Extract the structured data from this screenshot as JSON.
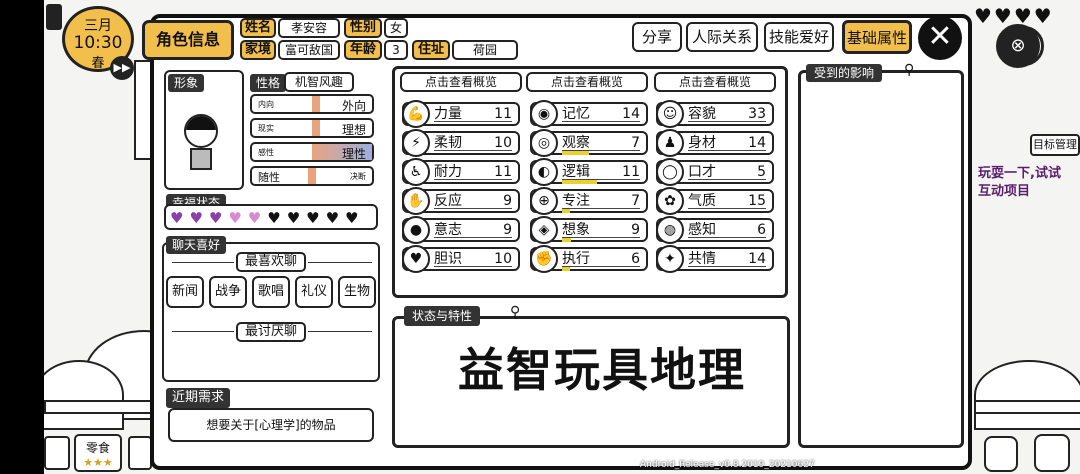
{
  "clock": {
    "month": "三月",
    "time": "10:30",
    "season": "春"
  },
  "tabs": {
    "active": "角色信息",
    "share": "分享",
    "relations": "人际关系",
    "skills": "技能爱好",
    "basic": "基础属性"
  },
  "profile": {
    "name_label": "姓名",
    "name": "孝安容",
    "gender_label": "性别",
    "gender": "女",
    "family_label": "家境",
    "family": "富可敌国",
    "age_label": "年龄",
    "age": "3",
    "address_label": "住址",
    "address": "荷园"
  },
  "portrait_label": "形象",
  "personality": {
    "label": "性格",
    "value": "机智风趣",
    "traits": [
      {
        "left": "内向",
        "right": "外向"
      },
      {
        "left": "现实",
        "right": "理想"
      },
      {
        "left": "感性",
        "right": "理性"
      },
      {
        "left": "随性",
        "right": "决断"
      }
    ]
  },
  "happiness_label": "幸福状态",
  "chat": {
    "label": "聊天喜好",
    "favorite_label": "最喜欢聊",
    "topics": [
      "新闻",
      "战争",
      "歌唱",
      "礼仪",
      "生物"
    ],
    "disliked_label": "最讨厌聊"
  },
  "needs": {
    "label": "近期需求",
    "text": "想要关于[心理学]的物品"
  },
  "overview_buttons": [
    "点击查看概览",
    "点击查看概览",
    "点击查看概览"
  ],
  "stats": {
    "col1": [
      {
        "name": "力量",
        "value": "11",
        "fill": 0
      },
      {
        "name": "柔韧",
        "value": "10",
        "fill": 0
      },
      {
        "name": "耐力",
        "value": "11",
        "fill": 0
      },
      {
        "name": "反应",
        "value": "9",
        "fill": 0
      },
      {
        "name": "意志",
        "value": "9",
        "fill": 0
      },
      {
        "name": "胆识",
        "value": "10",
        "fill": 0
      }
    ],
    "col2": [
      {
        "name": "记忆",
        "value": "14",
        "fill": 0
      },
      {
        "name": "观察",
        "value": "7",
        "fill": 0.35
      },
      {
        "name": "逻辑",
        "value": "11",
        "fill": 0.45
      },
      {
        "name": "专注",
        "value": "7",
        "fill": 0.1
      },
      {
        "name": "想象",
        "value": "9",
        "fill": 0.12
      },
      {
        "name": "执行",
        "value": "6",
        "fill": 0.1
      }
    ],
    "col3": [
      {
        "name": "容貌",
        "value": "33",
        "fill": 0
      },
      {
        "name": "身材",
        "value": "14",
        "fill": 0
      },
      {
        "name": "口才",
        "value": "5",
        "fill": 0
      },
      {
        "name": "气质",
        "value": "15",
        "fill": 0
      },
      {
        "name": "感知",
        "value": "6",
        "fill": 0
      },
      {
        "name": "共情",
        "value": "14",
        "fill": 0
      }
    ]
  },
  "status": {
    "label": "状态与特性",
    "big_text": "益智玩具地理"
  },
  "influence_label": "受到的影响",
  "right_hud": {
    "goal": "目标管理",
    "tip_line1": "玩耍一下,试试",
    "tip_line2": "互动项目"
  },
  "bottom": {
    "snack": "零食",
    "version": "Android_Release_v0.8.2019_20210627"
  }
}
